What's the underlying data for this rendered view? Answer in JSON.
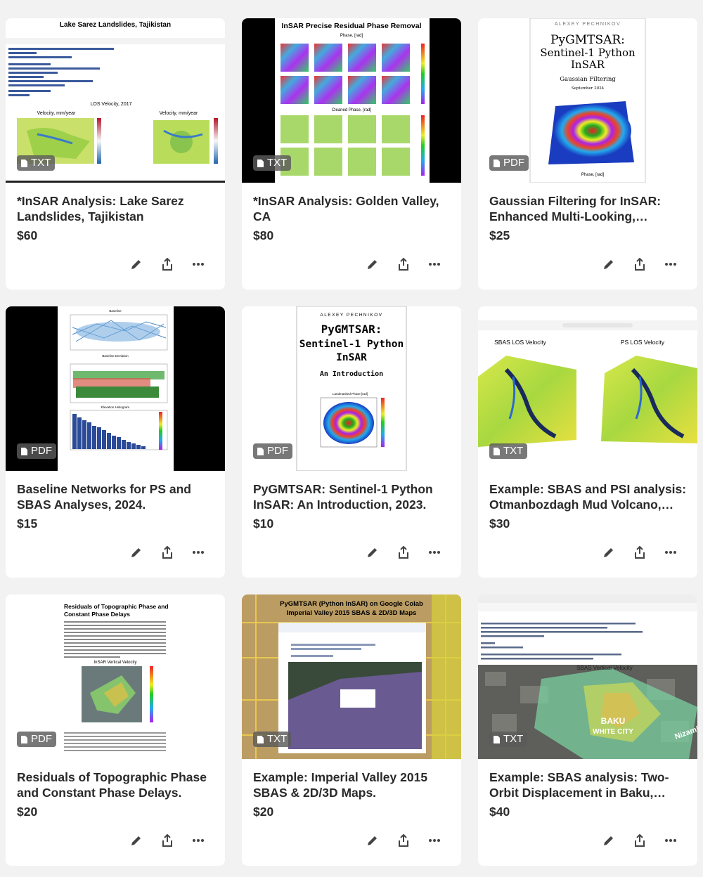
{
  "products": [
    {
      "title": "*InSAR Analysis: Lake Sarez Landslides, Tajikistan",
      "price": "$60",
      "format": "TXT",
      "thumb": {
        "heading": "Lake Sarez Landslides, Tajikistan",
        "sub": "LOS Velocity, 2017",
        "p1": "Velocity, mm/year",
        "p2": "Velocity, mm/year"
      }
    },
    {
      "title": "*InSAR Analysis: Golden Valley, CA",
      "price": "$80",
      "format": "TXT",
      "thumb": {
        "heading": "InSAR Precise Residual Phase Removal",
        "sub": "Phase, [rad]",
        "sub2": "Cleaned Phase, [rad]"
      }
    },
    {
      "title": "Gaussian Filtering for InSAR: Enhanced Multi-Looking,…",
      "price": "$25",
      "format": "PDF",
      "thumb": {
        "author": "ALEXEY PECHNIKOV",
        "heading1": "PyGMTSAR:",
        "heading2": "Sentinel-1 Python",
        "heading3": "InSAR",
        "sub": "Gaussian Filtering",
        "date": "September 2024",
        "axis": "Phase, [rad]"
      }
    },
    {
      "title": "Baseline Networks for PS and SBAS Analyses, 2024.",
      "price": "$15",
      "format": "PDF",
      "thumb": {
        "t1": "Baseline",
        "t2": "Baseline Deviation",
        "t3": "Elevation Histogram"
      }
    },
    {
      "title": "PyGMTSAR: Sentinel-1 Python InSAR: An Introduction, 2023.",
      "price": "$10",
      "format": "PDF",
      "thumb": {
        "author": "ALEXEY PECHNIKOV",
        "heading1": "PyGMTSAR:",
        "heading2": "Sentinel-1 Python",
        "heading3": "InSAR",
        "sub": "An Introduction",
        "plot": "Landmasked Phase [rad]"
      }
    },
    {
      "title": "Example: SBAS and PSI analysis: Otmanbozdagh Mud Volcano,…",
      "price": "$30",
      "format": "TXT",
      "thumb": {
        "left": "SBAS LOS Velocity",
        "right": "PS LOS Velocity"
      }
    },
    {
      "title": "Residuals of Topographic Phase and Constant Phase Delays.",
      "price": "$20",
      "format": "PDF",
      "thumb": {
        "heading1": "Residuals of Topographic Phase and",
        "heading2": "Constant Phase Delays",
        "plot": "InSAR Vertical Velocity"
      }
    },
    {
      "title": "Example: Imperial Valley 2015 SBAS & 2D/3D Maps.",
      "price": "$20",
      "format": "TXT",
      "thumb": {
        "heading1": "PyGMTSAR (Python InSAR) on Google Colab",
        "heading2": "Imperial Valley 2015 SBAS & 2D/3D Maps"
      }
    },
    {
      "title": "Example: SBAS analysis: Two-Orbit Displacement in Baku,…",
      "price": "$40",
      "format": "TXT",
      "thumb": {
        "plot": "SBAS Vertical Velocity",
        "label1": "BAKU",
        "label2": "WHITE CITY",
        "label3": "Nizami"
      }
    }
  ],
  "icons": {
    "edit": "pencil-icon",
    "share": "share-icon",
    "more": "more-icon",
    "file": "file-icon"
  }
}
